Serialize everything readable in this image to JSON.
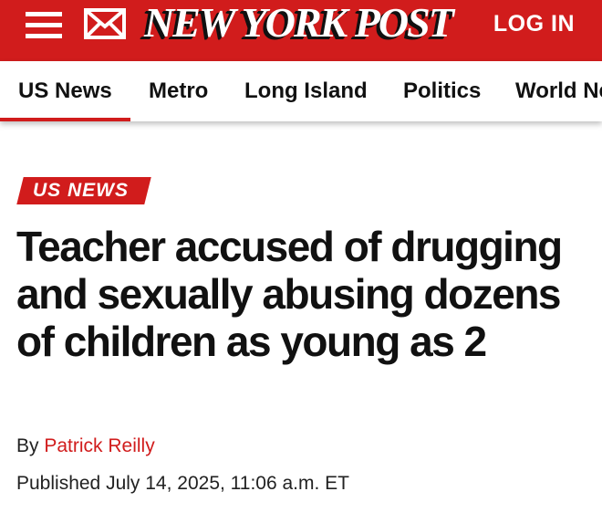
{
  "header": {
    "brand": "NEW YORK POST",
    "login_label": "LOG IN",
    "menu_icon": "hamburger-menu-icon",
    "mail_icon": "envelope-icon",
    "brand_color": "#d11c1c"
  },
  "nav": {
    "items": [
      {
        "label": "US News",
        "active": true
      },
      {
        "label": "Metro"
      },
      {
        "label": "Long Island"
      },
      {
        "label": "Politics"
      },
      {
        "label": "World News"
      }
    ]
  },
  "article": {
    "kicker": "US NEWS",
    "headline": "Teacher accused of drugging and sexually abusing dozens of children as young as 2",
    "byline_prefix": "By",
    "author": "Patrick Reilly",
    "published": "Published July 14, 2025, 11:06 a.m. ET"
  }
}
